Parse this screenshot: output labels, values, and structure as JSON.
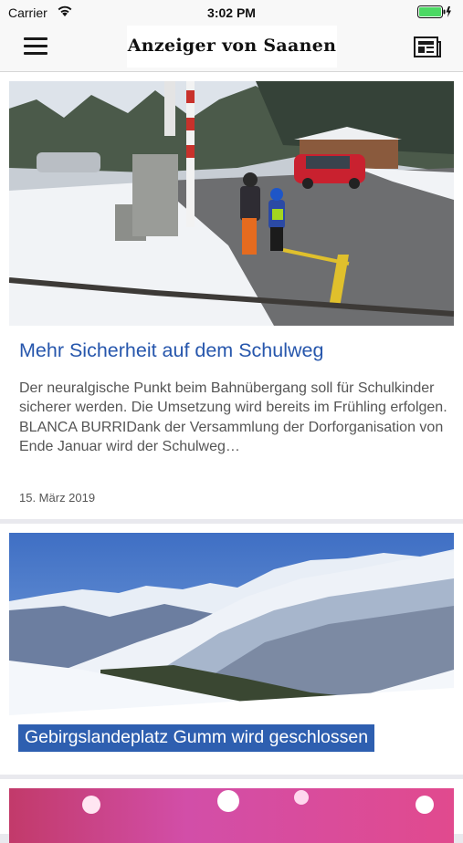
{
  "status_bar": {
    "carrier": "Carrier",
    "time": "3:02 PM"
  },
  "header": {
    "logo_text": "Anzeiger von Saanen",
    "menu_icon": "hamburger-menu-icon",
    "epaper_icon": "newspaper-icon"
  },
  "articles": [
    {
      "title": "Mehr Sicherheit auf dem Schulweg",
      "excerpt": "Der neuralgische Punkt beim Bahnübergang soll für Schulkinder sicherer werden. Die Umsetzung wird bereits im Frühling erfolgen.\nBLANCA BURRIDank der Versammlung der Dorforganisation von Ende Januar wird der Schulweg…",
      "date": "15. März 2019"
    },
    {
      "title": "Gebirgslandeplatz Gumm wird geschlossen"
    }
  ],
  "colors": {
    "link_title": "#2656ac",
    "overlay_bg": "#2e5fb0",
    "battery_green": "#4cd964"
  }
}
